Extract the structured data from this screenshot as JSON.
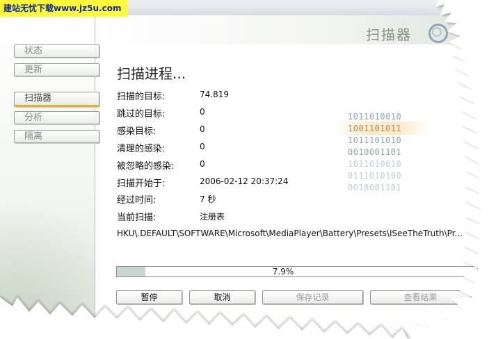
{
  "watermark": {
    "text": "建站无忧下载www.jz5u.com"
  },
  "header": {
    "title": "扫描器"
  },
  "sidebar": {
    "items": [
      {
        "label": "状态",
        "active": false
      },
      {
        "label": "更新",
        "active": false
      },
      {
        "label": "扫描器",
        "active": true
      },
      {
        "label": "分析",
        "active": false
      },
      {
        "label": "隔离",
        "active": false
      }
    ]
  },
  "main": {
    "title": "扫描进程...",
    "rows": [
      {
        "label": "扫描的目标:",
        "value": "74.819"
      },
      {
        "label": "跳过的目标:",
        "value": "0"
      },
      {
        "label": "感染目标:",
        "value": "0"
      },
      {
        "label": "清理的感染:",
        "value": "0"
      },
      {
        "label": "被忽略的感染:",
        "value": "0"
      },
      {
        "label": "扫描开始于:",
        "value": "2006-02-12 20:37:24"
      },
      {
        "label": "经过时间:",
        "value": "7 秒"
      },
      {
        "label": "当前扫描:",
        "value": "注册表"
      }
    ],
    "scan_path": "HKU\\.DEFAULT\\SOFTWARE\\Microsoft\\MediaPlayer\\Battery\\Presets\\ISeeTheTruth\\Pr...",
    "progress": {
      "value": 7.9,
      "label": "7.9%"
    },
    "binary_art": [
      "1011010010",
      "1001101011",
      "1011101010",
      "0010001101",
      "1011010010",
      "0111010100",
      "0010001101"
    ],
    "buttons": [
      {
        "label": "暂停",
        "enabled": true
      },
      {
        "label": "取消",
        "enabled": true
      },
      {
        "label": "保存记录",
        "enabled": false
      },
      {
        "label": "查看结果",
        "enabled": false
      }
    ]
  },
  "colors": {
    "accent": "#f0a830",
    "progress_fill": "#c9d6cd",
    "watermark_bg": "#fff93a",
    "watermark_text": "#0b2aa8",
    "binary_strong": "#8da3ad",
    "binary_faint": "#c3ccd1",
    "binary_highlight": "#c48a3c"
  }
}
